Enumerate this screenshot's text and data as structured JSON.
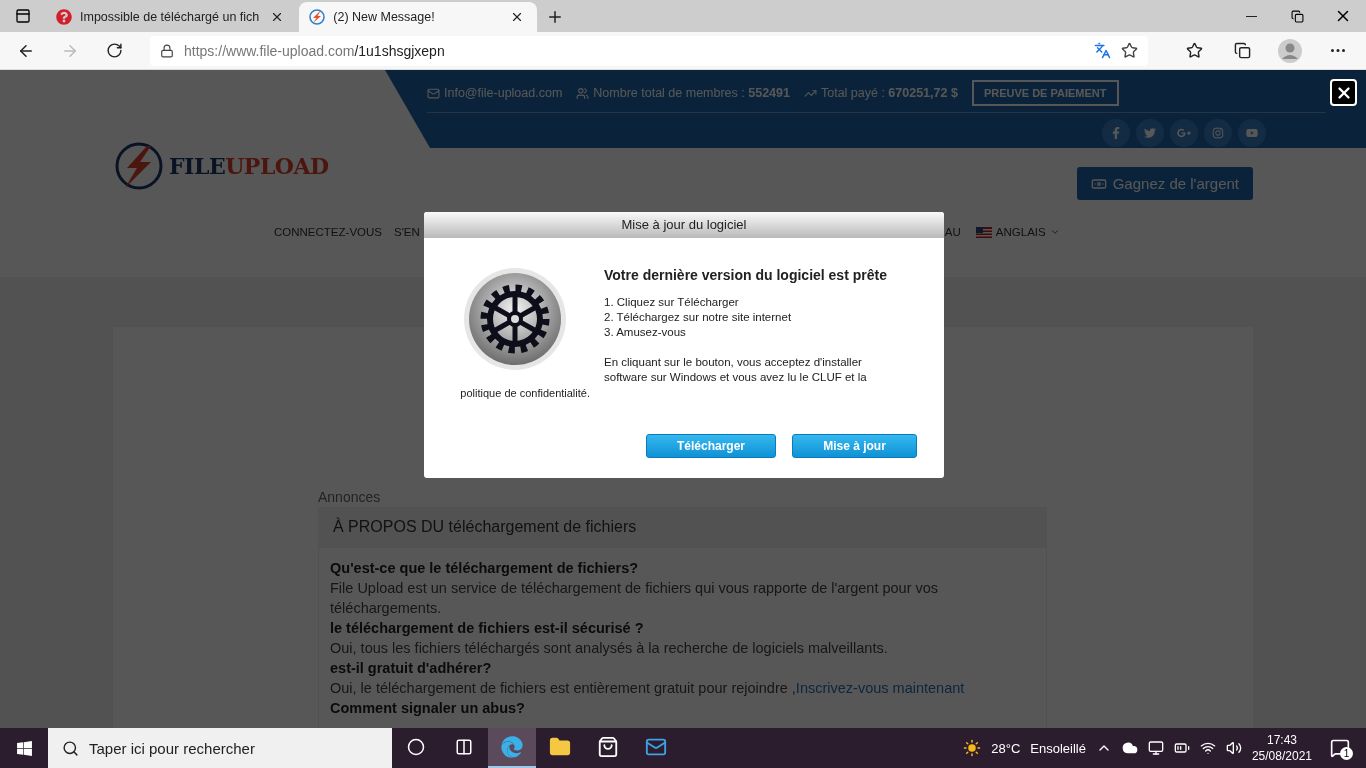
{
  "browser": {
    "tabs": [
      {
        "title": "Impossible de téléchargé un fich",
        "selected": false,
        "kind": "question"
      },
      {
        "title": "(2) New Message!",
        "selected": true,
        "kind": "bolt"
      }
    ],
    "url": {
      "host": "https://www.file-upload.com",
      "path": "/1u1shsgjxepn"
    }
  },
  "site": {
    "top_bar": {
      "email": "Info@file-upload.com",
      "members": "Nombre total de membres : **552491**",
      "paid": "Total payé : **670251,72 $**",
      "proof_button": "PREUVE DE PAIEMENT"
    },
    "logo": {
      "first": "FILE",
      "second": "UPLOAD"
    },
    "earn_button": "Gagnez de l'argent",
    "nav": [
      {
        "label": "CONNECTEZ-VOUS",
        "kind": "link"
      },
      {
        "label": "S'EN",
        "kind": "link"
      },
      {
        "label": "AU",
        "kind": "link"
      },
      {
        "label": "ANGLAIS",
        "kind": "language"
      }
    ],
    "announcements": {
      "label": "Annonces",
      "title": "À PROPOS DU téléchargement de fichiers",
      "faq": [
        {
          "q": "Qu'est-ce que le téléchargement de fichiers?",
          "a": "File Upload est un service de téléchargement de fichiers qui vous rapporte de l'argent pour vos téléchargements."
        },
        {
          "q": "le téléchargement de fichiers est-il sécurisé ?",
          "a": "Oui, tous les fichiers téléchargés sont analysés à la recherche de logiciels malveillants."
        },
        {
          "q": "est-il gratuit d'adhérer?",
          "a": "Oui, le téléchargement de fichiers est entièrement gratuit pour rejoindre ,",
          "link": "Inscrivez-vous maintenant"
        },
        {
          "q": "Comment signaler un abus?"
        }
      ]
    }
  },
  "modal": {
    "title": "Mise à jour du logiciel",
    "heading": "Votre dernière version du logiciel est prête",
    "steps": [
      "1. Cliquez sur Télécharger",
      "2. Téléchargez sur notre site internet",
      "3. Amusez-vous"
    ],
    "consent": "En cliquant sur le bouton, vous acceptez d'installer software sur Windows et vous avez lu le CLUF et la",
    "consent_tail": "politique de confidentialité.",
    "buttons": [
      "Télécharger",
      "Mise à jour"
    ]
  },
  "taskbar": {
    "search_placeholder": "Taper ici pour rechercher",
    "apps": [
      {
        "kind": "cortana",
        "selected": false
      },
      {
        "kind": "taskview",
        "selected": false
      },
      {
        "kind": "edge",
        "selected": true
      },
      {
        "kind": "folder",
        "selected": false
      },
      {
        "kind": "store",
        "selected": false
      },
      {
        "kind": "mail",
        "selected": false
      }
    ],
    "temperature": "28°C",
    "weather": "Ensoleillé",
    "time": "17:43",
    "date": "25/08/2021",
    "notifications": "1"
  }
}
